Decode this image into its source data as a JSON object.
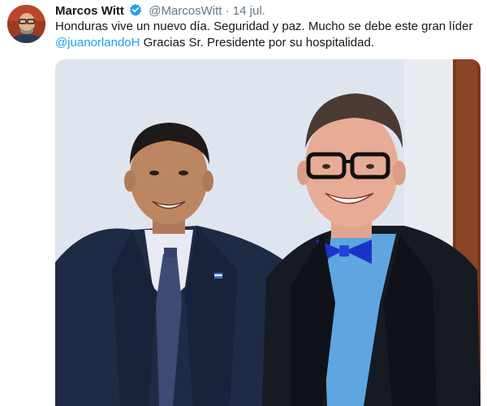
{
  "tweet": {
    "author_name": "Marcos Witt",
    "handle": "@MarcosWitt",
    "separator": "·",
    "date": "14 jul.",
    "text_part1": "Honduras vive un nuevo día. Seguridad y paz. Mucho se debe este gran líder ",
    "mention": "@juanorlandoH",
    "text_part2": " Gracias Sr. Presidente por su hospitalidad."
  },
  "icons": {
    "verified": "verified-badge-icon",
    "avatar": "profile-avatar"
  },
  "colors": {
    "link": "#1da1f2",
    "text": "#14171a",
    "secondary": "#657786"
  }
}
